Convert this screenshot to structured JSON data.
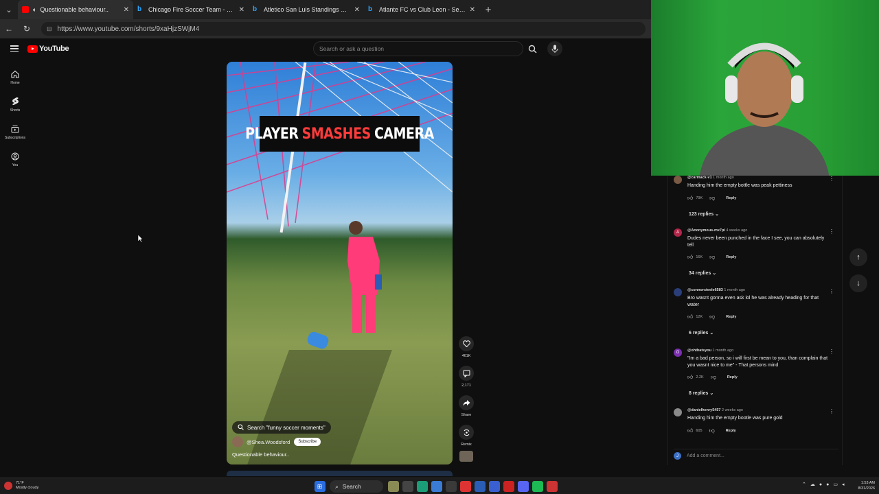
{
  "browser": {
    "tabs": [
      {
        "title": "Questionable behaviour..",
        "icon": "youtube-icon",
        "active": true
      },
      {
        "title": "Chicago Fire Soccer Team - Search",
        "icon": "bing-icon",
        "active": false
      },
      {
        "title": "Atletico San Luis Standings Soccer",
        "icon": "bing-icon",
        "active": false
      },
      {
        "title": "Atlante FC vs Club Leon - Search",
        "icon": "bing-icon",
        "active": false
      }
    ],
    "url": "https://www.youtube.com/shorts/9xaHjzSWjM4"
  },
  "youtube": {
    "logo_text": "YouTube",
    "search_placeholder": "Search or ask a question",
    "nav": [
      {
        "label": "Home",
        "icon": "home-icon"
      },
      {
        "label": "Shorts",
        "icon": "shorts-icon"
      },
      {
        "label": "Subscriptions",
        "icon": "subscriptions-icon"
      },
      {
        "label": "You",
        "icon": "you-icon"
      }
    ]
  },
  "video": {
    "banner": {
      "w1": "PLAYER",
      "w2": "SMASHES",
      "w3": "CAMERA"
    },
    "search_suggestion": "Search \"funny soccer moments\"",
    "channel": "@Shea.Woodsford",
    "subscribe_label": "Subscribe",
    "title": "Questionable behaviour..",
    "actions": [
      {
        "label": "461K",
        "icon": "like-icon"
      },
      {
        "label": "2,171",
        "icon": "comment-icon"
      },
      {
        "label": "Share",
        "icon": "share-icon"
      },
      {
        "label": "Remix",
        "icon": "remix-icon"
      }
    ]
  },
  "comments": [
    {
      "author": "@carmack-v1",
      "time": "1 month ago",
      "text": "Handing him the empty bottle was peak pettiness",
      "likes": "79K",
      "reply": "Reply",
      "replies": "123 replies",
      "avatar_color": "#7a5a44",
      "avatar_letter": ""
    },
    {
      "author": "@Anonymous-mx7pi",
      "time": "4 weeks ago",
      "text": "Dudes never been punched in the face I see, you can absolutely tell",
      "likes": "16K",
      "reply": "Reply",
      "replies": "34 replies",
      "avatar_color": "#b3264a",
      "avatar_letter": "A"
    },
    {
      "author": "@connorsteele6583",
      "time": "1 month ago",
      "text": "Bro wasnt gonna even ask lol he was already heading for that water",
      "likes": "12K",
      "reply": "Reply",
      "replies": "6 replies",
      "avatar_color": "#2a3f7a",
      "avatar_letter": ""
    },
    {
      "author": "@ohthatsyou",
      "time": "1 month ago",
      "text": "\"Im a bad person, so i will first be mean to you, than complain that you wasnt nice to me\" - That persons mind",
      "likes": "2.2K",
      "reply": "Reply",
      "replies": "8 replies",
      "avatar_color": "#7b2fb0",
      "avatar_letter": "O"
    },
    {
      "author": "@danielhenry5457",
      "time": "2 weeks ago",
      "text": "Handing him the empty bootle was pure gold",
      "likes": "605",
      "reply": "Reply",
      "replies": "",
      "avatar_color": "#8a8a8a",
      "avatar_letter": ""
    }
  ],
  "add_comment_placeholder": "Add a comment...",
  "add_comment_avatar": "J",
  "taskbar": {
    "weather_temp": "71°F",
    "weather_desc": "Mostly cloudy",
    "search_label": "Search",
    "time": "1:53 AM",
    "date": "8/31/2026"
  }
}
